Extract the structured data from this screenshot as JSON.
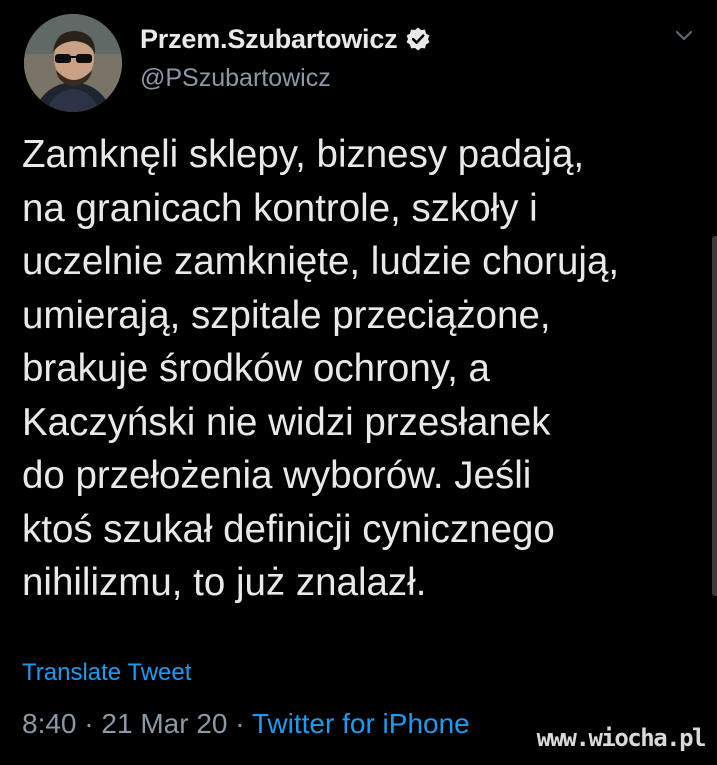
{
  "author": {
    "display_name": "Przem.Szubartowicz",
    "handle": "@PSzubartowicz",
    "verified_icon": "verified-badge-icon",
    "menu_icon": "chevron-down-icon"
  },
  "tweet": {
    "lines": [
      "Zamknęli sklepy, biznesy padają,",
      "na granicach kontrole, szkoły i",
      "uczelnie zamknięte, ludzie chorują,",
      "umierają, szpitale przeciążone,",
      "brakuje środków ochrony, a",
      "Kaczyński nie widzi przesłanek",
      "do przełożenia wyborów. Jeśli",
      "ktoś szukał definicji cynicznego",
      "nihilizmu, to już znalazł."
    ],
    "translate_label": "Translate Tweet",
    "time": "8:40",
    "separator": "·",
    "date": "21 Mar 20",
    "source": "Twitter for iPhone"
  },
  "watermark": "www.wiocha.pl",
  "colors": {
    "background": "#000000",
    "text": "#e7e9ea",
    "secondary": "#8b98a5",
    "link": "#1d9bf0"
  }
}
